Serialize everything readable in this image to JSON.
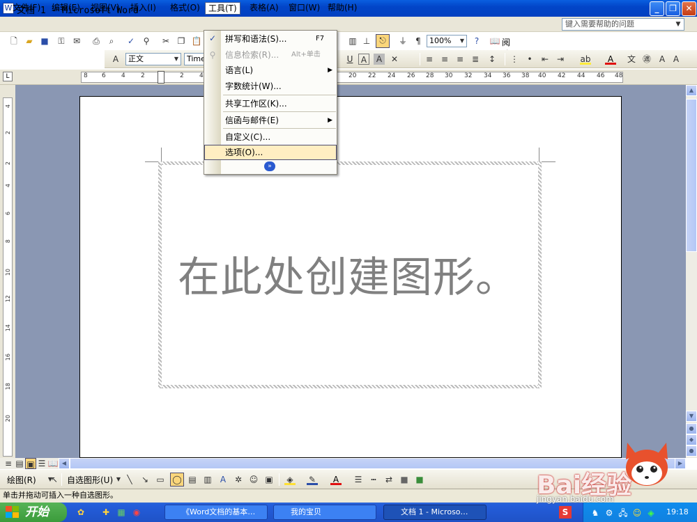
{
  "window": {
    "title": "文档 1 - Microsoft Word",
    "min_label": "_",
    "max_label": "❐",
    "close_label": "✕"
  },
  "menubar": {
    "items": [
      "文件(F)",
      "编辑(E)",
      "视图(V)",
      "插入(I)",
      "格式(O)",
      "工具(T)",
      "表格(A)",
      "窗口(W)",
      "帮助(H)"
    ],
    "help_placeholder": "键入需要帮助的问题"
  },
  "standard_toolbar": {
    "zoom": "100%",
    "read_label": "阅读"
  },
  "format_toolbar": {
    "style": "正文",
    "font": "Times"
  },
  "ruler": {
    "ticks": [
      "8",
      "6",
      "4",
      "2",
      "2",
      "4",
      "20",
      "22",
      "24",
      "26",
      "28",
      "30",
      "32",
      "34",
      "36",
      "38",
      "40",
      "42",
      "44",
      "46",
      "48"
    ]
  },
  "vruler": {
    "ticks": [
      "4",
      "2",
      "2",
      "4",
      "6",
      "8",
      "10",
      "12",
      "14",
      "16",
      "18",
      "20"
    ]
  },
  "tools_menu": {
    "items": [
      {
        "label": "拼写和语法(S)...",
        "shortcut": "F7"
      },
      {
        "label": "信息检索(R)...",
        "shortcut": "Alt+单击"
      },
      {
        "label": "语言(L)"
      },
      {
        "label": "字数统计(W)..."
      },
      {
        "label": "共享工作区(K)..."
      },
      {
        "label": "信函与邮件(E)"
      },
      {
        "label": "自定义(C)..."
      },
      {
        "label": "选项(O)..."
      }
    ]
  },
  "canvas": {
    "text": "在此处创建图形。"
  },
  "drawing_toolbar": {
    "draw_label": "绘图(R)",
    "autoshape_label": "自选图形(U)"
  },
  "status": {
    "text": "单击并拖动可插入一种自选图形。"
  },
  "taskbar": {
    "start_label": "开始",
    "tasks": [
      "《Word文档的基本…",
      "我的宝贝",
      "文档 1 - Microso…"
    ],
    "clock": "19:18"
  },
  "watermark": {
    "brand": "Bai经验",
    "url": "jingyan.baidu.com"
  }
}
